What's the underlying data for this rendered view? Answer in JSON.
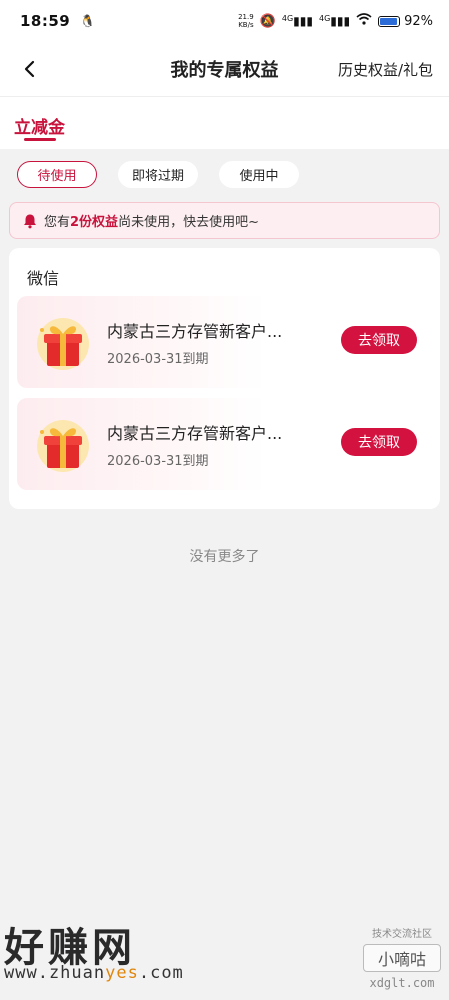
{
  "status_bar": {
    "time": "18:59",
    "net_speed": "21.9",
    "net_unit": "KB/s",
    "signal1": "4G",
    "signal2": "4G",
    "battery": "92%",
    "battery_level": 0.92
  },
  "header": {
    "title": "我的专属权益",
    "right_link": "历史权益/礼包"
  },
  "tabs": {
    "active": "立减金"
  },
  "filters": [
    "待使用",
    "即将过期",
    "使用中"
  ],
  "notice": {
    "prefix": "您有",
    "highlight": "2份权益",
    "suffix": "尚未使用，快去使用吧~"
  },
  "section": {
    "title": "微信",
    "items": [
      {
        "name": "内蒙古三方存管新客户...",
        "expiry": "2026-03-31到期",
        "button": "去领取"
      },
      {
        "name": "内蒙古三方存管新客户...",
        "expiry": "2026-03-31到期",
        "button": "去领取"
      }
    ]
  },
  "footer": {
    "no_more": "没有更多了"
  },
  "watermark": {
    "left_text": "好赚网",
    "url_prefix": "www.zhuan",
    "url_highlight": "yes",
    "url_suffix": ".com",
    "right_small": "技术交流社区",
    "right_box": "小嘀咕",
    "right_site": "xdglt.com"
  },
  "colors": {
    "accent": "#c8133d",
    "button": "#d4123f",
    "notice_bg": "#fdeff1"
  }
}
